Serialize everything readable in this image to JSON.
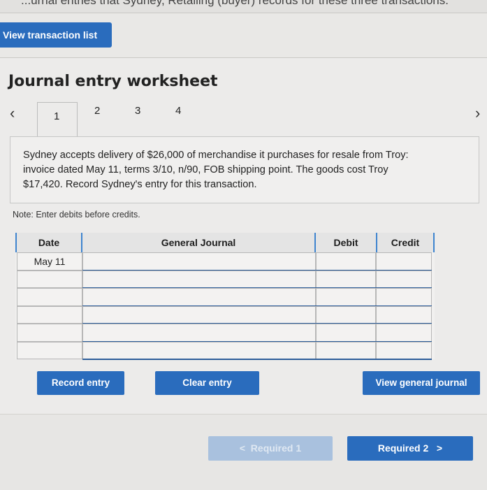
{
  "top_strip_text": "...urnal entries that Sydney, Retailing (buyer) records for these three transactions.",
  "view_transaction_label": "View transaction list",
  "worksheet_title": "Journal entry worksheet",
  "tabs": [
    "1",
    "2",
    "3",
    "4"
  ],
  "active_tab": "1",
  "prev_icon": "chevron-left-icon",
  "next_icon": "chevron-right-icon",
  "question": "Sydney accepts delivery of $26,000 of merchandise it purchases for resale from Troy: invoice dated May 11, terms 3/10, n/90, FOB shipping point. The goods cost Troy $17,420. Record Sydney's entry for this transaction.",
  "note": "Note: Enter debits before credits.",
  "table": {
    "headers": {
      "date": "Date",
      "journal": "General Journal",
      "debit": "Debit",
      "credit": "Credit"
    },
    "rows": [
      {
        "date": "May 11",
        "account": "",
        "debit": "",
        "credit": ""
      },
      {
        "date": "",
        "account": "",
        "debit": "",
        "credit": ""
      },
      {
        "date": "",
        "account": "",
        "debit": "",
        "credit": ""
      },
      {
        "date": "",
        "account": "",
        "debit": "",
        "credit": ""
      },
      {
        "date": "",
        "account": "",
        "debit": "",
        "credit": ""
      },
      {
        "date": "",
        "account": "",
        "debit": "",
        "credit": ""
      }
    ]
  },
  "buttons": {
    "record": "Record entry",
    "clear": "Clear entry",
    "view_journal": "View general journal"
  },
  "nav": {
    "prev": "Required 1",
    "next": "Required 2",
    "prev_glyph": "<",
    "next_glyph": ">"
  },
  "colors": {
    "accent": "#2a6cbd",
    "header_blue": "#3e84cf"
  }
}
